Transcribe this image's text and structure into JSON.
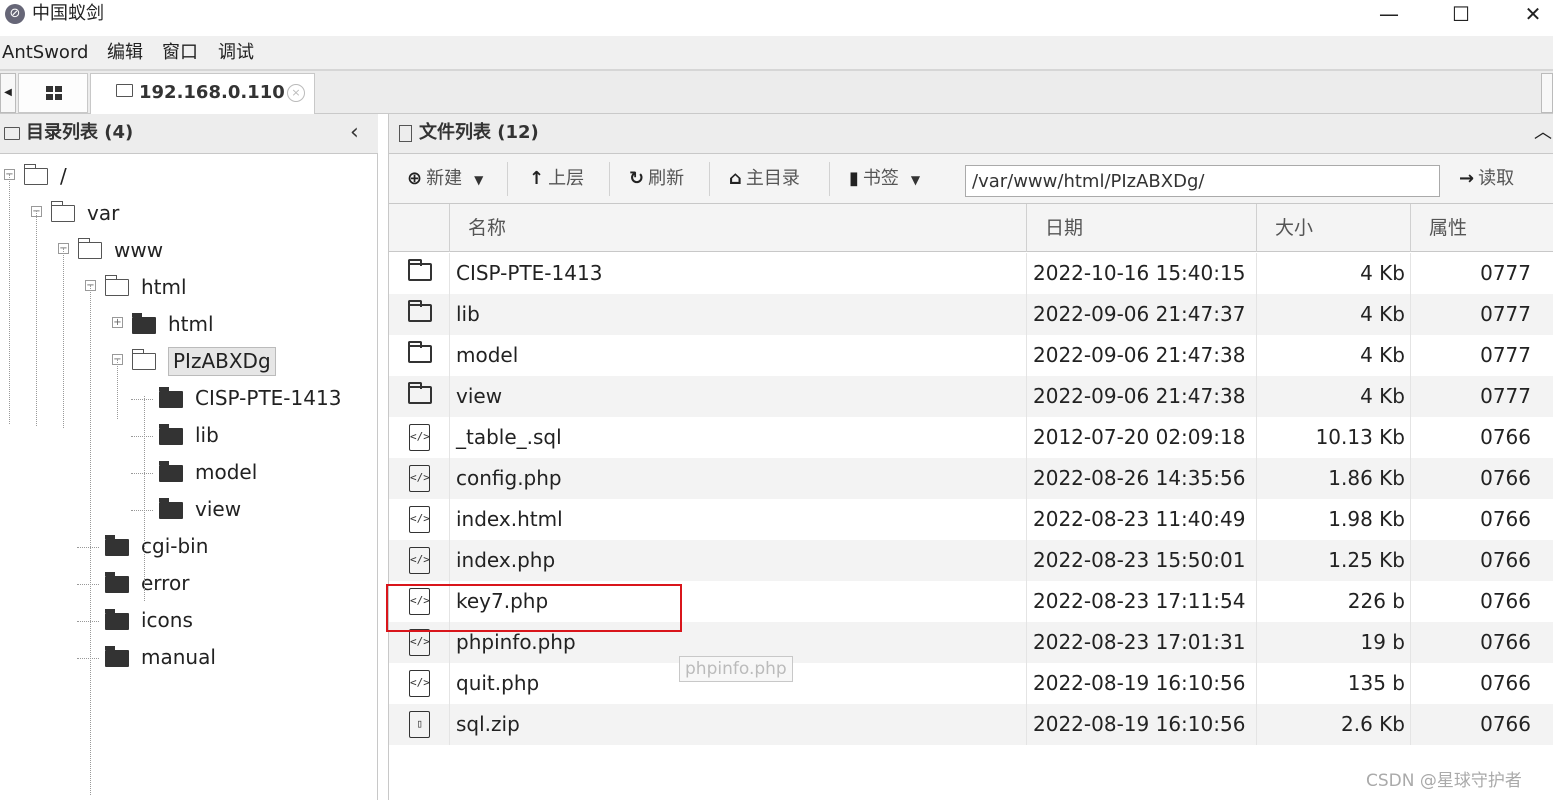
{
  "window": {
    "title": "中国蚁剑",
    "minimize_glyph": "—",
    "maximize_glyph": "☐",
    "close_glyph": "✕"
  },
  "menu": [
    "AntSword",
    "编辑",
    "窗口",
    "调试"
  ],
  "tabs": {
    "active_label": "192.168.0.110",
    "close_glyph": "×"
  },
  "dir_panel": {
    "title": "目录列表 (4)",
    "collapse_glyph": "‹",
    "tree": [
      {
        "label": "/",
        "toggle": "−",
        "icon": "outline"
      },
      {
        "label": "var",
        "toggle": "−",
        "icon": "outline"
      },
      {
        "label": "www",
        "toggle": "−",
        "icon": "outline"
      },
      {
        "label": "html",
        "toggle": "−",
        "icon": "outline"
      },
      {
        "label": "html",
        "toggle": "+",
        "icon": "filled"
      },
      {
        "label": "PIzABXDg",
        "toggle": "−",
        "icon": "outline",
        "selected": true
      },
      {
        "label": "CISP-PTE-1413",
        "toggle": "",
        "icon": "filled"
      },
      {
        "label": "lib",
        "toggle": "",
        "icon": "filled"
      },
      {
        "label": "model",
        "toggle": "",
        "icon": "filled"
      },
      {
        "label": "view",
        "toggle": "",
        "icon": "filled"
      },
      {
        "label": "cgi-bin",
        "toggle": "",
        "icon": "filled"
      },
      {
        "label": "error",
        "toggle": "",
        "icon": "filled"
      },
      {
        "label": "icons",
        "toggle": "",
        "icon": "filled"
      },
      {
        "label": "manual",
        "toggle": "",
        "icon": "filled"
      }
    ]
  },
  "file_panel": {
    "title": "文件列表 (12)",
    "toolbar": {
      "new_label": "新建",
      "up_label": "上层",
      "refresh_label": "刷新",
      "home_label": "主目录",
      "bookmark_label": "书签",
      "path_value": "/var/www/html/PIzABXDg/",
      "read_label": "读取"
    },
    "columns": [
      "名称",
      "日期",
      "大小",
      "属性"
    ],
    "files": [
      {
        "type": "folder",
        "name": "CISP-PTE-1413",
        "date": "2022-10-16 15:40:15",
        "size": "4 Kb",
        "attr": "0777"
      },
      {
        "type": "folder",
        "name": "lib",
        "date": "2022-09-06 21:47:37",
        "size": "4 Kb",
        "attr": "0777"
      },
      {
        "type": "folder",
        "name": "model",
        "date": "2022-09-06 21:47:38",
        "size": "4 Kb",
        "attr": "0777"
      },
      {
        "type": "folder",
        "name": "view",
        "date": "2022-09-06 21:47:38",
        "size": "4 Kb",
        "attr": "0777"
      },
      {
        "type": "code",
        "name": "_table_.sql",
        "date": "2012-07-20 02:09:18",
        "size": "10.13 Kb",
        "attr": "0766"
      },
      {
        "type": "code",
        "name": "config.php",
        "date": "2022-08-26 14:35:56",
        "size": "1.86 Kb",
        "attr": "0766"
      },
      {
        "type": "code",
        "name": "index.html",
        "date": "2022-08-23 11:40:49",
        "size": "1.98 Kb",
        "attr": "0766"
      },
      {
        "type": "code",
        "name": "index.php",
        "date": "2022-08-23 15:50:01",
        "size": "1.25 Kb",
        "attr": "0766"
      },
      {
        "type": "code",
        "name": "key7.php",
        "date": "2022-08-23 17:11:54",
        "size": "226 b",
        "attr": "0766"
      },
      {
        "type": "code",
        "name": "phpinfo.php",
        "date": "2022-08-23 17:01:31",
        "size": "19 b",
        "attr": "0766"
      },
      {
        "type": "code",
        "name": "quit.php",
        "date": "2022-08-19 16:10:56",
        "size": "135 b",
        "attr": "0766"
      },
      {
        "type": "zip",
        "name": "sql.zip",
        "date": "2022-08-19 16:10:56",
        "size": "2.6 Kb",
        "attr": "0766"
      }
    ],
    "tooltip": "phpinfo.php"
  },
  "watermark": "CSDN @星球守护者",
  "colors": {
    "highlight": "#d9151b",
    "alt_row": "#f3f3f3"
  }
}
